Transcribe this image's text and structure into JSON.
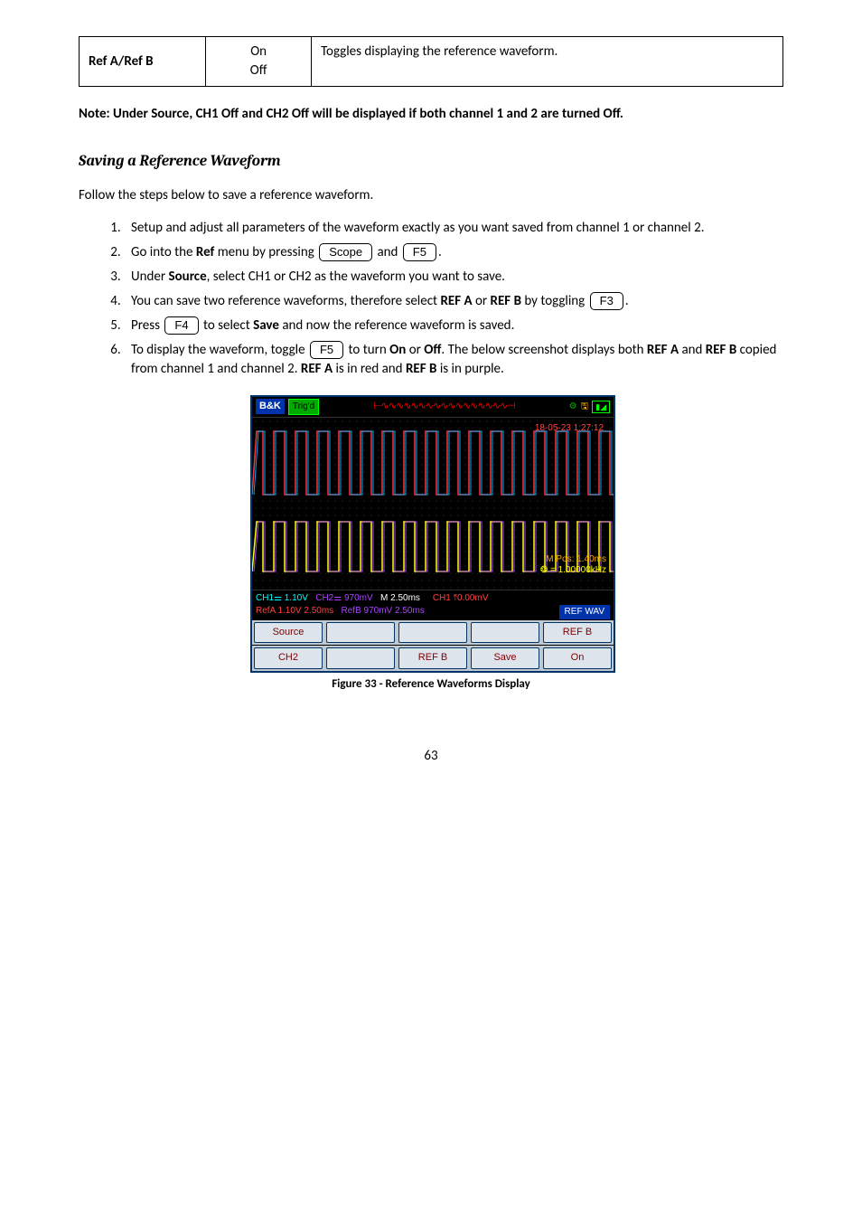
{
  "option_table": {
    "label": "Ref A/Ref B",
    "val1": "On",
    "val2": "Off",
    "desc": "Toggles displaying the reference waveform."
  },
  "note": "Note:  Under Source, CH1 Off and CH2 Off will be displayed if both channel 1 and 2 are turned Off.",
  "heading": "Saving a Reference Waveform",
  "intro": "Follow the steps below to save a reference waveform.",
  "steps": {
    "s1": "Setup and adjust all parameters of the waveform exactly as you want saved from channel 1 or channel 2.",
    "s2a": "Go into the ",
    "s2b": "Ref",
    "s2c": " menu by pressing ",
    "s2d": " and ",
    "s2e": ".",
    "s3a": "Under ",
    "s3b": "Source",
    "s3c": ", select CH1 or CH2 as the waveform you want to save.",
    "s4a": "You can save two reference waveforms, therefore select ",
    "s4b": "REF A",
    "s4c": " or ",
    "s4d": "REF B",
    "s4e": " by toggling ",
    "s4f": ".",
    "s5a": "Press ",
    "s5b": " to select ",
    "s5c": "Save",
    "s5d": " and now the reference waveform is saved.",
    "s6a": "To display the waveform, toggle ",
    "s6b": " to turn ",
    "s6c": "On",
    "s6d": " or ",
    "s6e": "Off",
    "s6f": ".  The below screenshot displays both ",
    "s6g": "REF A",
    "s6h": " and ",
    "s6i": "REF B",
    "s6j": " copied from channel 1 and channel 2.  ",
    "s6k": "REF A",
    "s6l": " is in red and ",
    "s6m": "REF B",
    "s6n": " is in purple."
  },
  "keys": {
    "scope": "Scope",
    "f5": "F5",
    "f3": "F3",
    "f4": "F4",
    "f5b": "F5"
  },
  "scope": {
    "logo": "B&K",
    "trigd": "Trig'd",
    "timestamp": "18-05-23 1:27:12",
    "mpos": "M Pos: 1.40ms",
    "freq": "❂ = 1.00000kHz",
    "ch1": "CH1⚌ 1.10V",
    "ch2": "CH2⚌ 970mV",
    "m": "M 2.50ms",
    "ch1f": "CH1 ⤒0.00mV",
    "refa": "RefA 1.10V 2.50ms",
    "refb": "RefB 970mV 2.50ms",
    "refwav": "REF WAV",
    "btn1": "Source",
    "btn2": "",
    "btn3": "",
    "btn4": "",
    "btn5": "REF B",
    "btn1b": "CH2",
    "btn2b": "",
    "btn3b": "REF B",
    "btn4b": "Save",
    "btn5b": "On"
  },
  "figcap": "Figure 33 - Reference Waveforms Display",
  "pagenum": "63"
}
